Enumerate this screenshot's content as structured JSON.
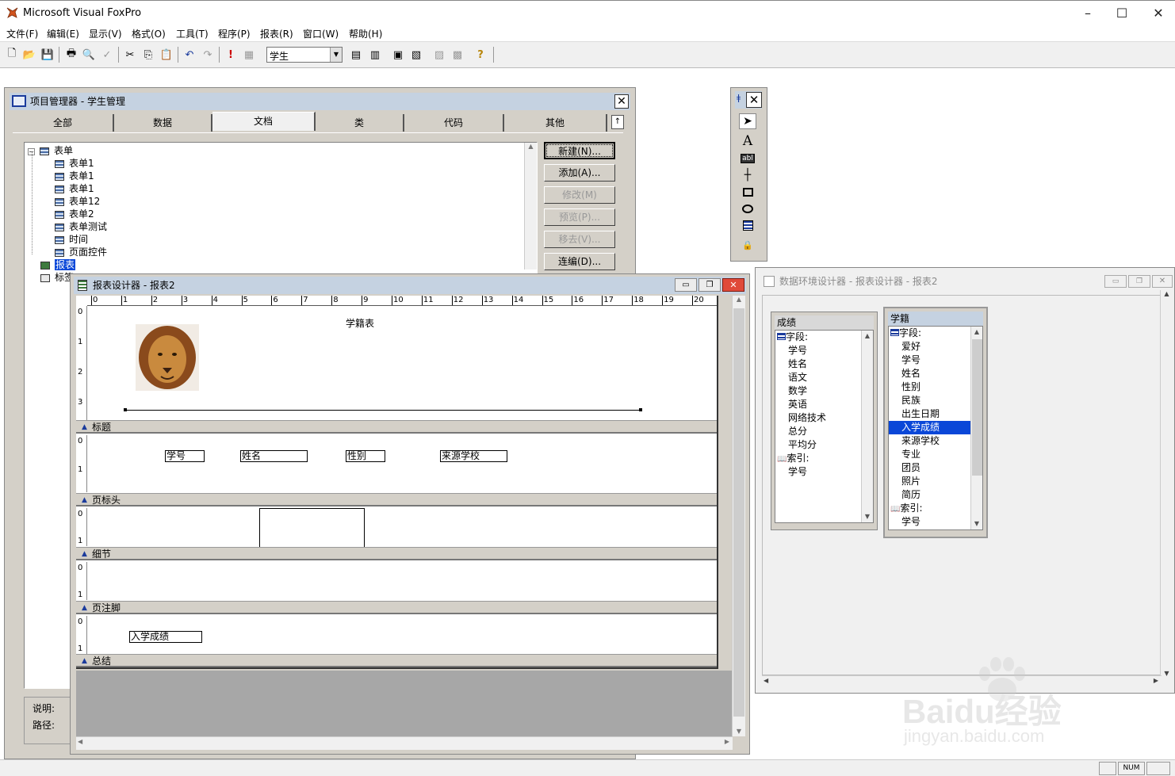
{
  "app": {
    "title": "Microsoft Visual FoxPro"
  },
  "menu": [
    "文件(F)",
    "编辑(E)",
    "显示(V)",
    "格式(O)",
    "工具(T)",
    "程序(P)",
    "报表(R)",
    "窗口(W)",
    "帮助(H)"
  ],
  "toolbar": {
    "combo_value": "学生"
  },
  "project_manager": {
    "title": "项目管理器 - 学生管理",
    "tabs": [
      "全部",
      "数据",
      "文档",
      "类",
      "代码",
      "其他"
    ],
    "active_tab": "文档",
    "tree": {
      "forms_label": "表单",
      "forms": [
        "表单1",
        "表单1",
        "表单1",
        "表单12",
        "表单2",
        "表单测试",
        "时间",
        "页面控件"
      ],
      "reports_label": "报表",
      "labels_label": "标签"
    },
    "buttons": {
      "new": "新建(N)...",
      "add": "添加(A)...",
      "modify": "修改(M)",
      "preview": "预览(P)...",
      "remove": "移去(V)...",
      "build": "连编(D)..."
    },
    "desc_label": "说明:",
    "path_label": "路径:"
  },
  "report_designer": {
    "title": "报表设计器 - 报表2",
    "ruler": [
      "0",
      "1",
      "2",
      "3",
      "4",
      "5",
      "6",
      "7",
      "8",
      "9",
      "10",
      "11",
      "12",
      "13",
      "14",
      "15",
      "16",
      "17",
      "18",
      "19",
      "20"
    ],
    "title_band_vruler": [
      "0",
      "1",
      "2",
      "3"
    ],
    "small_vruler": [
      "0",
      "1"
    ],
    "report_title": "学籍表",
    "bands": {
      "title": "标题",
      "page_header": "页标头",
      "detail": "细节",
      "page_footer": "页注脚",
      "summary": "总结"
    },
    "header_fields": [
      "学号",
      "姓名",
      "性别",
      "来源学校"
    ],
    "summary_field": "入学成绩"
  },
  "data_env": {
    "title": "数据环境设计器 - 报表设计器 - 报表2",
    "tables": [
      {
        "name": "成绩",
        "fields_label": "字段:",
        "fields": [
          "学号",
          "姓名",
          "语文",
          "数学",
          "英语",
          "网络技术",
          "总分",
          "平均分"
        ],
        "index_label": "索引:",
        "indexes": [
          "学号"
        ]
      },
      {
        "name": "学籍",
        "fields_label": "字段:",
        "fields": [
          "爱好",
          "学号",
          "姓名",
          "性别",
          "民族",
          "出生日期",
          "入学成绩",
          "来源学校",
          "专业",
          "团员",
          "照片",
          "简历"
        ],
        "index_label": "索引:",
        "indexes": [
          "学号"
        ],
        "selected": "入学成绩"
      }
    ]
  },
  "status": {
    "num": "NUM"
  },
  "watermark": {
    "brand": "Baidu经验",
    "url": "jingyan.baidu.com"
  },
  "colors": {
    "active_caption": "#c5d2e1",
    "selection": "#0a47d8",
    "close_red": "#e04a3a"
  }
}
